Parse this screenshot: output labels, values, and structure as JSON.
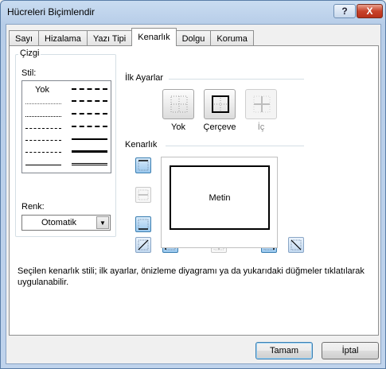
{
  "window": {
    "title": "Hücreleri Biçimlendir",
    "help_symbol": "?",
    "close_symbol": "X"
  },
  "tabs": [
    {
      "label": "Sayı"
    },
    {
      "label": "Hizalama"
    },
    {
      "label": "Yazı Tipi"
    },
    {
      "label": "Kenarlık",
      "active": true
    },
    {
      "label": "Dolgu"
    },
    {
      "label": "Koruma"
    }
  ],
  "line_section": {
    "group_label": "Çizgi",
    "style_label": "Stil:",
    "none_label": "Yok",
    "color_label": "Renk:",
    "color_value": "Otomatik"
  },
  "presets": {
    "group_label": "İlk Ayarlar",
    "none_label": "Yok",
    "outline_label": "Çerçeve",
    "inside_label": "İç"
  },
  "border": {
    "group_label": "Kenarlık",
    "preview_text": "Metin"
  },
  "description": "Seçilen kenarlık stili; ilk ayarlar, önizleme diyagramı ya da yukarıdaki düğmeler tıklatılarak uygulanabilir.",
  "buttons": {
    "ok": "Tamam",
    "cancel": "İptal"
  },
  "colors": {
    "accent": "#3c7fb1",
    "close_red": "#c8432b"
  }
}
